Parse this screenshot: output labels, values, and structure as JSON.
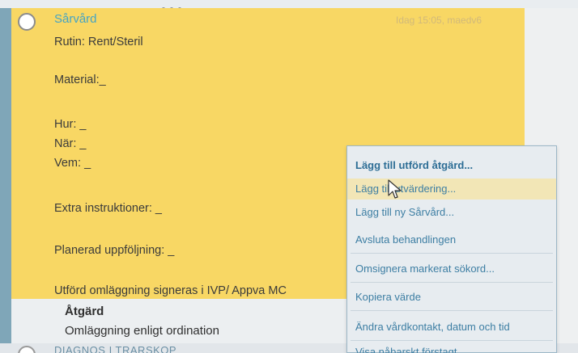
{
  "card": {
    "title": "Sårvård",
    "meta": "Idag 15:05, maedv6",
    "lines": [
      "Rutin: Rent/Steril",
      "Material:_",
      "Hur: _",
      "När: _",
      "Vem: _",
      "Extra instruktioner: _",
      "Planerad uppföljning: _",
      "Utförd omläggning signeras i IVP/ Appva MC"
    ]
  },
  "action": {
    "heading": "Åtgärd",
    "text": "Omläggning enligt ordination"
  },
  "next_section": {
    "label": "DIAGNOS I TRARSKOP"
  },
  "context_menu": {
    "items": [
      "Lägg till utförd åtgärd...",
      "Lägg till utvärdering...",
      "Lägg till ny Sårvård...",
      "Avsluta behandlingen",
      "Omsignera markerat sökord...",
      "Kopiera värde",
      "Ändra vårdkontakt, datum och tid",
      "Visa nåbarskt förstagt…"
    ]
  },
  "colors": {
    "card_background": "#f8d764",
    "title_color": "#45a4c4",
    "menu_text": "#3d7ea3"
  }
}
